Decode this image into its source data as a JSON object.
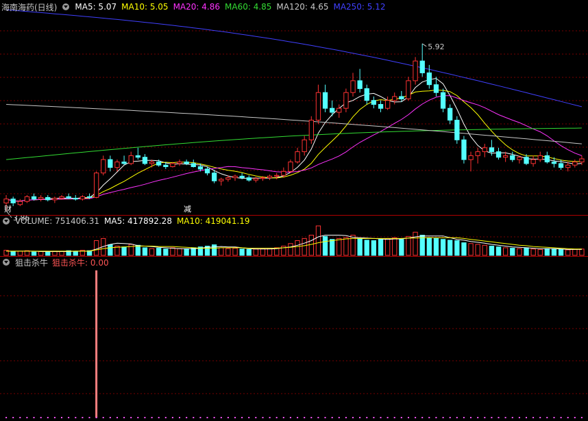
{
  "header": {
    "stock_title": "海南海药(日线)",
    "ma_items": [
      {
        "label": "MA5: 5.07",
        "color": "#ffffff"
      },
      {
        "label": "MA10: 5.05",
        "color": "#ffff00"
      },
      {
        "label": "MA20: 4.86",
        "color": "#ff33ff"
      },
      {
        "label": "MA60: 4.85",
        "color": "#33dd33"
      },
      {
        "label": "MA120: 4.65",
        "color": "#c8c8c8"
      },
      {
        "label": "MA250: 5.12",
        "color": "#4040ff"
      }
    ]
  },
  "volume_header": {
    "items": [
      {
        "label": "VOLUME: 751406.31",
        "color": "#c8c8c8"
      },
      {
        "label": "MA5: 417892.28",
        "color": "#ffffff"
      },
      {
        "label": "MA10: 419041.19",
        "color": "#ffff00"
      }
    ]
  },
  "indicator_header": {
    "name": "狙击杀牛",
    "value_label": "狙击杀牛: 0.00",
    "value_color": "#ff5555"
  },
  "colors": {
    "up": "#ff3232",
    "down": "#54ffff",
    "grid": "#7a0000",
    "separator": "#b00000"
  },
  "chart_data": {
    "type": "candlestick",
    "price_annotations": {
      "high": "5.92",
      "low": "3.86"
    },
    "event_markers": [
      "财",
      "减"
    ],
    "ohlc": [
      [
        3.9,
        4.0,
        3.8,
        3.95
      ],
      [
        3.95,
        3.98,
        3.86,
        3.9
      ],
      [
        3.88,
        3.95,
        3.86,
        3.92
      ],
      [
        3.92,
        4.0,
        3.9,
        3.98
      ],
      [
        3.98,
        4.02,
        3.93,
        3.95
      ],
      [
        3.95,
        4.0,
        3.92,
        3.97
      ],
      [
        3.97,
        4.0,
        3.92,
        3.94
      ],
      [
        3.94,
        3.98,
        3.9,
        3.96
      ],
      [
        3.96,
        4.0,
        3.94,
        3.98
      ],
      [
        3.98,
        4.02,
        3.95,
        3.96
      ],
      [
        3.96,
        4.0,
        3.93,
        3.95
      ],
      [
        3.95,
        4.0,
        3.93,
        3.98
      ],
      [
        3.98,
        4.02,
        3.95,
        3.97
      ],
      [
        3.97,
        4.3,
        3.96,
        4.28
      ],
      [
        4.28,
        4.5,
        4.25,
        4.45
      ],
      [
        4.45,
        4.5,
        4.3,
        4.35
      ],
      [
        4.35,
        4.45,
        4.3,
        4.42
      ],
      [
        4.42,
        4.5,
        4.38,
        4.4
      ],
      [
        4.4,
        4.55,
        4.38,
        4.5
      ],
      [
        4.5,
        4.6,
        4.45,
        4.48
      ],
      [
        4.48,
        4.52,
        4.38,
        4.4
      ],
      [
        4.4,
        4.45,
        4.35,
        4.42
      ],
      [
        4.42,
        4.45,
        4.36,
        4.38
      ],
      [
        4.38,
        4.42,
        4.33,
        4.36
      ],
      [
        4.36,
        4.42,
        4.35,
        4.4
      ],
      [
        4.4,
        4.45,
        4.37,
        4.42
      ],
      [
        4.42,
        4.45,
        4.38,
        4.4
      ],
      [
        4.4,
        4.45,
        4.35,
        4.36
      ],
      [
        4.36,
        4.4,
        4.3,
        4.33
      ],
      [
        4.33,
        4.36,
        4.25,
        4.28
      ],
      [
        4.28,
        4.32,
        4.15,
        4.18
      ],
      [
        4.18,
        4.22,
        4.12,
        4.2
      ],
      [
        4.2,
        4.25,
        4.17,
        4.22
      ],
      [
        4.22,
        4.26,
        4.18,
        4.24
      ],
      [
        4.24,
        4.28,
        4.2,
        4.22
      ],
      [
        4.22,
        4.25,
        4.17,
        4.19
      ],
      [
        4.19,
        4.23,
        4.16,
        4.21
      ],
      [
        4.21,
        4.24,
        4.18,
        4.22
      ],
      [
        4.22,
        4.26,
        4.19,
        4.24
      ],
      [
        4.24,
        4.28,
        4.2,
        4.25
      ],
      [
        4.25,
        4.35,
        4.22,
        4.3
      ],
      [
        4.3,
        4.45,
        4.28,
        4.42
      ],
      [
        4.42,
        4.6,
        4.4,
        4.55
      ],
      [
        4.55,
        4.75,
        4.5,
        4.7
      ],
      [
        4.7,
        5.0,
        4.65,
        4.95
      ],
      [
        4.95,
        5.4,
        4.9,
        5.3
      ],
      [
        5.3,
        5.4,
        5.05,
        5.1
      ],
      [
        5.1,
        5.2,
        5.0,
        5.05
      ],
      [
        5.05,
        5.15,
        4.98,
        5.1
      ],
      [
        5.1,
        5.35,
        5.05,
        5.3
      ],
      [
        5.3,
        5.55,
        5.25,
        5.45
      ],
      [
        5.45,
        5.6,
        5.3,
        5.35
      ],
      [
        5.35,
        5.4,
        5.15,
        5.2
      ],
      [
        5.2,
        5.25,
        5.1,
        5.15
      ],
      [
        5.15,
        5.2,
        5.05,
        5.1
      ],
      [
        5.1,
        5.25,
        5.08,
        5.2
      ],
      [
        5.2,
        5.3,
        5.15,
        5.25
      ],
      [
        5.25,
        5.32,
        5.18,
        5.22
      ],
      [
        5.22,
        5.5,
        5.2,
        5.45
      ],
      [
        5.45,
        5.75,
        5.4,
        5.7
      ],
      [
        5.7,
        5.92,
        5.5,
        5.55
      ],
      [
        5.55,
        5.65,
        5.35,
        5.4
      ],
      [
        5.4,
        5.5,
        5.25,
        5.3
      ],
      [
        5.3,
        5.35,
        5.05,
        5.1
      ],
      [
        5.1,
        5.15,
        4.9,
        4.95
      ],
      [
        4.95,
        5.0,
        4.65,
        4.7
      ],
      [
        4.7,
        4.75,
        4.4,
        4.45
      ],
      [
        4.45,
        4.55,
        4.3,
        4.5
      ],
      [
        4.5,
        4.6,
        4.4,
        4.55
      ],
      [
        4.55,
        4.65,
        4.48,
        4.6
      ],
      [
        4.6,
        4.7,
        4.5,
        4.55
      ],
      [
        4.55,
        4.6,
        4.45,
        4.48
      ],
      [
        4.48,
        4.55,
        4.42,
        4.5
      ],
      [
        4.5,
        4.55,
        4.42,
        4.45
      ],
      [
        4.45,
        4.5,
        4.4,
        4.48
      ],
      [
        4.48,
        4.52,
        4.38,
        4.4
      ],
      [
        4.4,
        4.5,
        4.36,
        4.45
      ],
      [
        4.45,
        4.55,
        4.42,
        4.5
      ],
      [
        4.5,
        4.55,
        4.4,
        4.42
      ],
      [
        4.42,
        4.48,
        4.35,
        4.4
      ],
      [
        4.4,
        4.45,
        4.32,
        4.35
      ],
      [
        4.35,
        4.42,
        4.3,
        4.38
      ],
      [
        4.38,
        4.45,
        4.35,
        4.42
      ],
      [
        4.42,
        4.5,
        4.38,
        4.46
      ]
    ],
    "volume": [
      12,
      9,
      10,
      11,
      8,
      9,
      8,
      10,
      9,
      11,
      10,
      12,
      11,
      35,
      40,
      25,
      22,
      20,
      26,
      24,
      18,
      16,
      17,
      15,
      18,
      16,
      15,
      18,
      20,
      22,
      25,
      18,
      16,
      17,
      15,
      14,
      15,
      16,
      17,
      18,
      22,
      28,
      35,
      40,
      48,
      70,
      45,
      38,
      40,
      42,
      48,
      40,
      36,
      35,
      38,
      40,
      42,
      38,
      45,
      55,
      48,
      42,
      40,
      38,
      36,
      35,
      30,
      28,
      26,
      24,
      22,
      20,
      18,
      17,
      16,
      18,
      15,
      14,
      16,
      15,
      14,
      13,
      14,
      15
    ],
    "volume_ma5": [
      10,
      10,
      10,
      10,
      10,
      9,
      9,
      9,
      9,
      9,
      10,
      10,
      10,
      15,
      21,
      26,
      29,
      28,
      27,
      23,
      22,
      21,
      19,
      18,
      17,
      16,
      16,
      16,
      17,
      19,
      20,
      21,
      20,
      20,
      18,
      16,
      15,
      15,
      15,
      16,
      18,
      20,
      24,
      29,
      35,
      44,
      48,
      48,
      48,
      47,
      43,
      42,
      41,
      40,
      39,
      38,
      39,
      39,
      41,
      44,
      46,
      46,
      46,
      46,
      42,
      38,
      36,
      33,
      31,
      29,
      26,
      24,
      22,
      20,
      19,
      18,
      17,
      16,
      16,
      16,
      15,
      14,
      14,
      14
    ],
    "volume_ma10": [
      10,
      10,
      10,
      10,
      10,
      10,
      10,
      10,
      10,
      10,
      10,
      10,
      10,
      13,
      16,
      18,
      19,
      20,
      21,
      22,
      22,
      22,
      21,
      21,
      21,
      20,
      19,
      18,
      17,
      17,
      17,
      18,
      18,
      18,
      18,
      17,
      17,
      17,
      17,
      17,
      18,
      19,
      21,
      23,
      26,
      30,
      33,
      35,
      37,
      39,
      40,
      40,
      40,
      40,
      40,
      40,
      40,
      40,
      41,
      41,
      42,
      42,
      42,
      42,
      42,
      42,
      40,
      38,
      36,
      34,
      32,
      30,
      28,
      26,
      24,
      23,
      21,
      20,
      19,
      18,
      17,
      16,
      15,
      15
    ],
    "indicator": {
      "name": "狙击杀牛",
      "signal_index": 13,
      "signal_value": 1,
      "last_value": 0.0
    }
  }
}
